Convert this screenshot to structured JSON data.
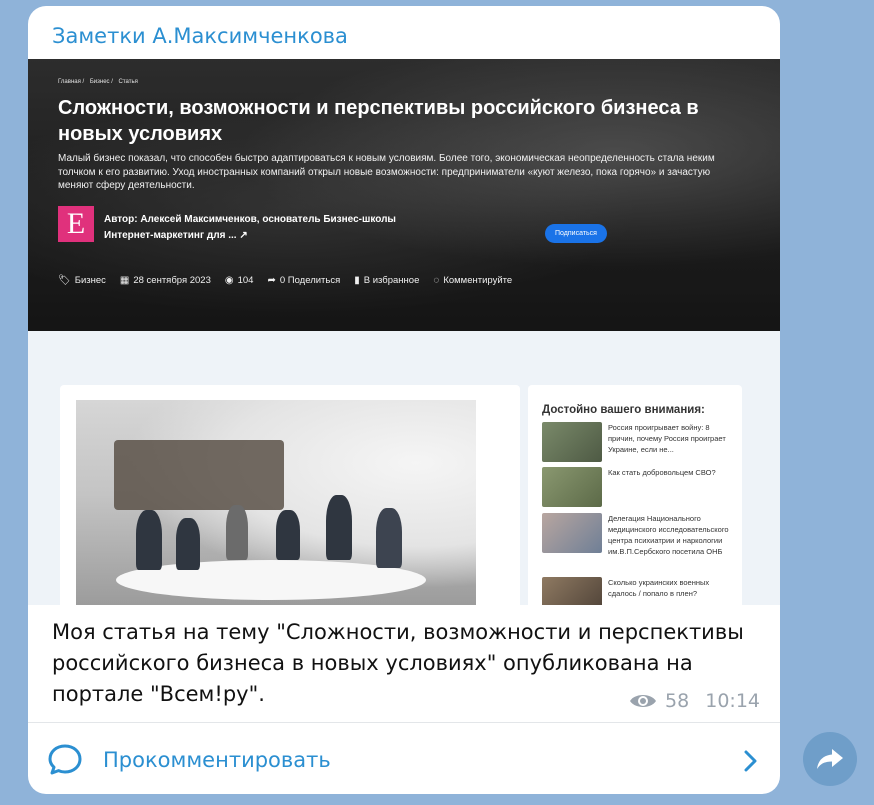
{
  "channel": {
    "title": "Заметки А.Максимченкова"
  },
  "article": {
    "breadcrumbs": [
      "Главная /",
      "Бизнес /",
      "Статья"
    ],
    "title": "Сложности, возможности и перспективы российского бизнеса в новых условиях",
    "lead": "Малый бизнес показал, что способен быстро адаптироваться к новым условиям. Более того, экономическая неопределенность стала неким толчком к его развитию. Уход иностранных компаний открыл новые возможности: предприниматели «куют железо, пока горячо» и зачастую меняют сферу деятельности.",
    "author_logo_letter": "E",
    "author_line1": "Автор: Алексей Максимченков, основатель Бизнес-школы",
    "author_line2": "Интернет-маркетинг для ... ",
    "subscribe_label": "Подписаться",
    "meta": {
      "category": "Бизнес",
      "date": "28 сентября 2023",
      "views": "104",
      "share": "0 Поделиться",
      "favorites": "В избранное",
      "comment": "Комментируйте"
    }
  },
  "sidebar": {
    "title": "Достойно вашего внимания:",
    "items": [
      {
        "text": "Россия проигрывает войну: 8 причин, почему Россия проиграет Украине, если не..."
      },
      {
        "text": "Как стать добровольцем СВО?"
      },
      {
        "text": "Делегация Национального медицинского исследовательского центра психиатрии и наркологии им.В.П.Сербского посетила ОНБ"
      },
      {
        "text": "Сколько украинских военных сдалось / попало в плен?"
      }
    ]
  },
  "message": {
    "text": "Моя статья на тему \"Сложности, возможности и перспективы российского бизнеса в новых условиях\" опубликована на портале \"Всем!ру\".",
    "views": "58",
    "time": "10:14"
  },
  "footer": {
    "comment_label": "Прокомментировать"
  },
  "colors": {
    "accent": "#2b8fd1",
    "background": "#8fb3d9",
    "share_button": "#6f9ec9"
  },
  "icons": {
    "views": "eye-icon",
    "comment": "comment-bubble-icon",
    "chevron": "chevron-right-icon",
    "share": "share-arrow-icon"
  }
}
